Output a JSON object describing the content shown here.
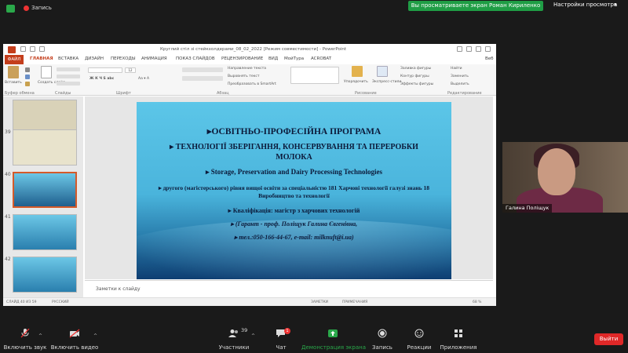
{
  "zoom_top": {
    "recording_label": "Запись",
    "viewing_text": "Вы просматриваете экран Роман Кириленко",
    "view_options": "Настройки просмотра",
    "colors": {
      "viewing_pill": "#1f9d45",
      "record": "#e33333"
    }
  },
  "powerpoint": {
    "window_title": "Круглий стіл зі стейкхолдерами_08_02_2022 [Режим совместимости] - PowerPoint",
    "tabs": [
      "ФАЙЛ",
      "ГЛАВНАЯ",
      "ВСТАВКА",
      "ДИЗАЙН",
      "ПЕРЕХОДЫ",
      "АНИМАЦИЯ",
      "ПОКАЗ СЛАЙДОВ",
      "РЕЦЕНЗИРОВАНИЕ",
      "ВИД",
      "МойТура",
      "ACROBAT"
    ],
    "account": "Веб",
    "ribbon": {
      "paste": "Вставить",
      "create_slide": "Создать слайд",
      "clipboard": "Буфер обмена",
      "slides": "Слайды",
      "font": "Шрифт",
      "paragraph": "Абзац",
      "text_direction": "Направление текста",
      "align_text": "Выровнять текст",
      "convert_smartart": "Преобразовать в SmartArt",
      "arrange": "Упорядочить",
      "quick_styles": "Экспресс-стили",
      "shape_fill": "Заливка фигуры",
      "shape_outline": "Контур фигуры",
      "shape_effects": "Эффекты фигуры",
      "drawing": "Рисование",
      "find": "Найти",
      "replace": "Заменить",
      "select": "Выделить",
      "editing": "Редактирование",
      "font_size": "12"
    },
    "thumbnails": [
      {
        "num": "",
        "active": false
      },
      {
        "num": "39",
        "active": false
      },
      {
        "num": "40",
        "active": true
      },
      {
        "num": "41",
        "active": false
      },
      {
        "num": "42",
        "active": false
      }
    ],
    "slide": {
      "line1": "▸ОСВІТНЬО-ПРОФЕСІЙНА  ПРОГРАМА",
      "line2": "▸ ТЕХНОЛОГІЇ ЗБЕРІГАННЯ, КОНСЕРВУВАННЯ ТА ПЕРЕРОБКИ МОЛОКА",
      "line3": "▸ Storage, Preservation and Dairy Processing Technologies",
      "line4": "▸ другого  (магістерського) рівня вищої освіти за спеціальністю 181 Харчові технології  галузі знань 18 Виробництво та технології",
      "line5": "▸ Кваліфікація: магістр з харчових технологій",
      "line6": "▸ (Гарант - проф. Поліщук Галина Євгенівна,",
      "line7": "▸ тел.:050-166-44-67, e-mail: milknuft@i.ua)"
    },
    "notes_placeholder": "Заметки к слайду",
    "status": {
      "slide_counter": "СЛАЙД 40 ИЗ 59",
      "language": "РУССКИЙ",
      "notes": "ЗАМЕТКИ",
      "comments": "ПРИМЕЧАНИЯ",
      "zoom": "68 %"
    }
  },
  "participant": {
    "name": "Галина Поліщук"
  },
  "toolbar": {
    "audio": "Включить звук",
    "video": "Включить видео",
    "participants": "Участники",
    "participants_count": "39",
    "chat": "Чат",
    "chat_badge": "1",
    "share": "Демонстрация экрана",
    "record": "Запись",
    "reactions": "Реакции",
    "apps": "Приложения",
    "leave": "Выйти",
    "colors": {
      "leave": "#e02828",
      "share": "#2aa84a",
      "muted": "#e33333"
    }
  }
}
